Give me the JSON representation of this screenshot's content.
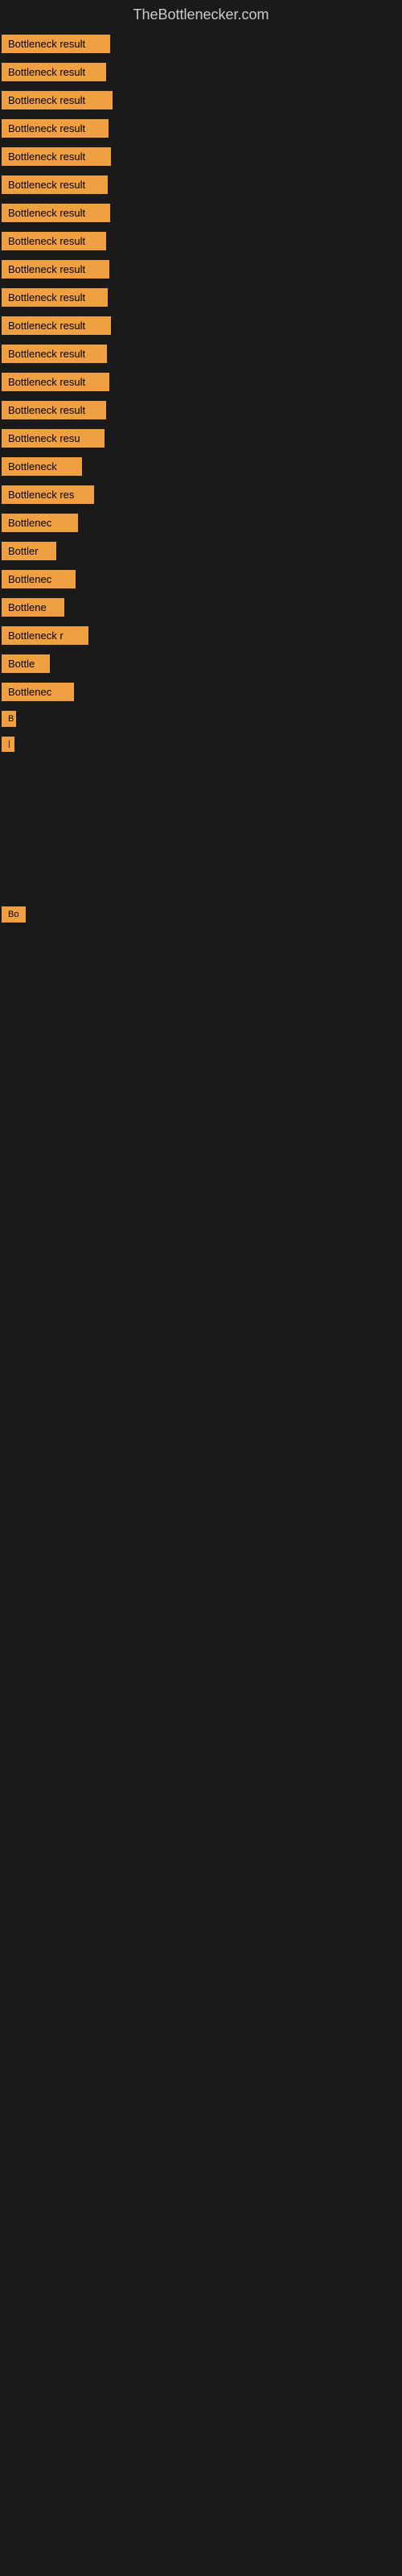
{
  "site": {
    "title": "TheBottlenecker.com"
  },
  "rows": [
    {
      "id": 1,
      "label": "Bottleneck result",
      "visible": true
    },
    {
      "id": 2,
      "label": "Bottleneck result",
      "visible": true
    },
    {
      "id": 3,
      "label": "Bottleneck result",
      "visible": true
    },
    {
      "id": 4,
      "label": "Bottleneck result",
      "visible": true
    },
    {
      "id": 5,
      "label": "Bottleneck result",
      "visible": true
    },
    {
      "id": 6,
      "label": "Bottleneck result",
      "visible": true
    },
    {
      "id": 7,
      "label": "Bottleneck result",
      "visible": true
    },
    {
      "id": 8,
      "label": "Bottleneck result",
      "visible": true
    },
    {
      "id": 9,
      "label": "Bottleneck result",
      "visible": true
    },
    {
      "id": 10,
      "label": "Bottleneck result",
      "visible": true
    },
    {
      "id": 11,
      "label": "Bottleneck result",
      "visible": true
    },
    {
      "id": 12,
      "label": "Bottleneck result",
      "visible": true
    },
    {
      "id": 13,
      "label": "Bottleneck result",
      "visible": true
    },
    {
      "id": 14,
      "label": "Bottleneck result",
      "visible": true
    },
    {
      "id": 15,
      "label": "Bottleneck resu",
      "visible": true
    },
    {
      "id": 16,
      "label": "Bottleneck",
      "visible": true
    },
    {
      "id": 17,
      "label": "Bottleneck res",
      "visible": true
    },
    {
      "id": 18,
      "label": "Bottlenec",
      "visible": true
    },
    {
      "id": 19,
      "label": "Bottler",
      "visible": true
    },
    {
      "id": 20,
      "label": "Bottlenec",
      "visible": true
    },
    {
      "id": 21,
      "label": "Bottlene",
      "visible": true
    },
    {
      "id": 22,
      "label": "Bottleneck r",
      "visible": true
    },
    {
      "id": 23,
      "label": "Bottle",
      "visible": true
    },
    {
      "id": 24,
      "label": "Bottlenec",
      "visible": true
    },
    {
      "id": 25,
      "label": "B",
      "visible": true
    },
    {
      "id": 26,
      "label": "|",
      "visible": true
    },
    {
      "id": 27,
      "label": "",
      "visible": false
    },
    {
      "id": 28,
      "label": "",
      "visible": false
    },
    {
      "id": 29,
      "label": "",
      "visible": false
    },
    {
      "id": 30,
      "label": "Bo",
      "visible": true
    },
    {
      "id": 31,
      "label": "",
      "visible": false
    },
    {
      "id": 32,
      "label": "",
      "visible": false
    },
    {
      "id": 33,
      "label": "",
      "visible": false
    },
    {
      "id": 34,
      "label": "",
      "visible": false
    }
  ]
}
